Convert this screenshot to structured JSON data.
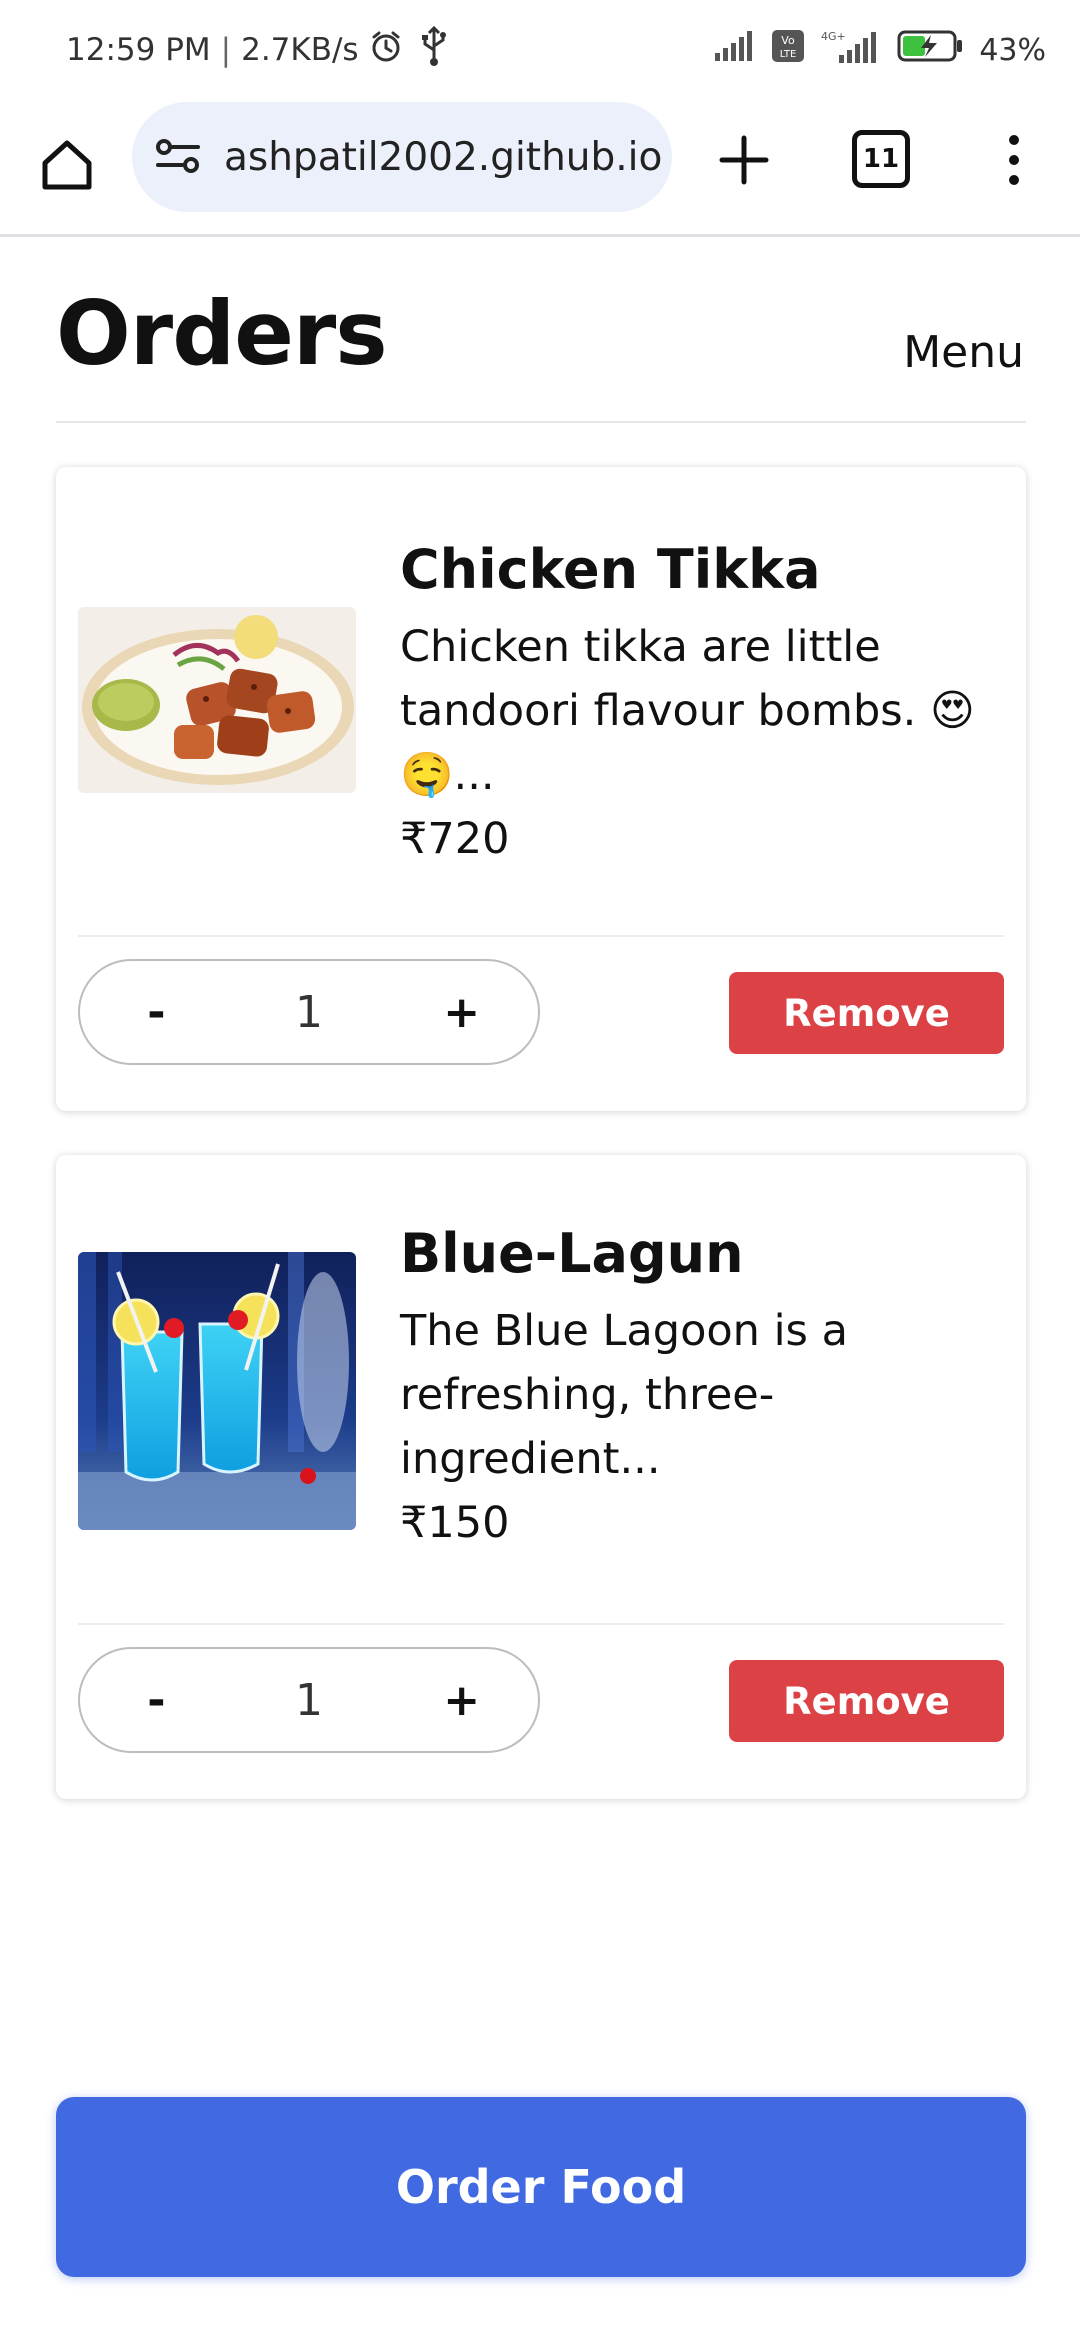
{
  "status_bar": {
    "time": "12:59 PM",
    "separator": "|",
    "network_speed": "2.7KB/s",
    "battery": "43%",
    "icons": [
      "alarm-icon",
      "usb-icon",
      "signal-icon",
      "volte-icon",
      "signal-4g-icon",
      "battery-charging-icon"
    ],
    "volte_label": "Vo LTE",
    "net_label": "4G+"
  },
  "browser": {
    "url": "ashpatil2002.github.io",
    "tab_count": "11",
    "icons": [
      "home-icon",
      "site-settings-icon",
      "new-tab-icon",
      "tabs-icon",
      "more-options-icon"
    ]
  },
  "header": {
    "title": "Orders",
    "menu_label": "Menu"
  },
  "orders": [
    {
      "name": "Chicken Tikka",
      "description": "Chicken tikka are little tandoori flavour bombs. 😍🤤...",
      "price": "₹720",
      "quantity": "1",
      "decrement_label": "-",
      "increment_label": "+",
      "remove_label": "Remove",
      "image": "chicken-tikka-plate-image"
    },
    {
      "name": "Blue-Lagun",
      "description": "The Blue Lagoon is a refreshing, three-ingredient...",
      "price": "₹150",
      "quantity": "1",
      "decrement_label": "-",
      "increment_label": "+",
      "remove_label": "Remove",
      "image": "blue-lagoon-drinks-image"
    }
  ],
  "order_button_label": "Order Food",
  "colors": {
    "remove": "#dc4145",
    "primary": "#4169e1",
    "url_pill": "#ecf0fa"
  }
}
